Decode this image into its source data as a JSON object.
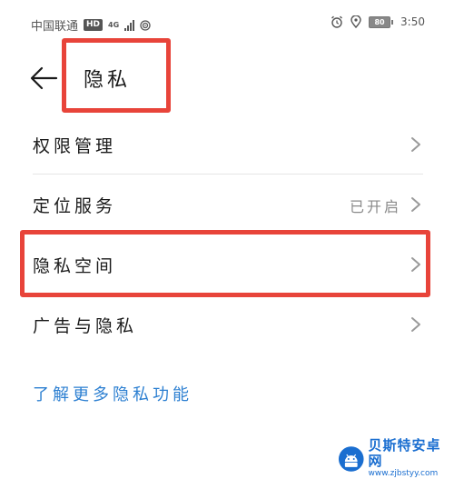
{
  "status_bar": {
    "carrier": "中国联通",
    "hd": "HD",
    "network": "4G",
    "battery": "80",
    "time": "3:50",
    "icons": [
      "signal-icon",
      "hotspot-icon",
      "alarm-icon",
      "location-icon",
      "battery-icon"
    ]
  },
  "header": {
    "back_icon": "arrow-left-icon",
    "title": "隐私"
  },
  "list": {
    "items": [
      {
        "label": "权限管理",
        "value": ""
      },
      {
        "label": "定位服务",
        "value": "已开启"
      },
      {
        "label": "隐私空间",
        "value": ""
      },
      {
        "label": "广告与隐私",
        "value": ""
      }
    ]
  },
  "footer": {
    "learn_more": "了解更多隐私功能"
  },
  "watermark": {
    "name": "贝斯特安卓网",
    "url": "www.zjbstyy.com"
  },
  "colors": {
    "highlight": "#e8443a",
    "link": "#2c7fd1",
    "watermark": "#1a6ed0"
  }
}
